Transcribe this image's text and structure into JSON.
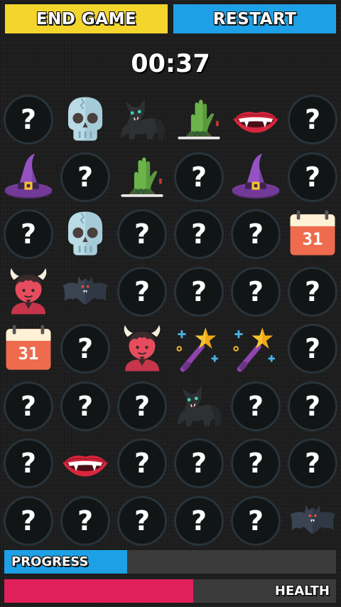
{
  "buttons": {
    "end_game": "END GAME",
    "restart": "RESTART"
  },
  "timer": "00:37",
  "hidden_symbol": "?",
  "board": {
    "columns": 6,
    "rows": [
      [
        "hidden",
        "skull",
        "black-cat",
        "zombie-hand",
        "vampire-lips",
        "hidden"
      ],
      [
        "witch-hat",
        "hidden",
        "zombie-hand",
        "hidden",
        "witch-hat",
        "hidden"
      ],
      [
        "hidden",
        "skull",
        "hidden",
        "hidden",
        "hidden",
        "calendar"
      ],
      [
        "devil",
        "bat",
        "hidden",
        "hidden",
        "hidden",
        "hidden"
      ],
      [
        "calendar",
        "hidden",
        "devil",
        "magic-wand",
        "magic-wand",
        "hidden"
      ],
      [
        "hidden",
        "hidden",
        "hidden",
        "black-cat",
        "hidden",
        "hidden"
      ],
      [
        "hidden",
        "vampire-lips",
        "hidden",
        "hidden",
        "hidden",
        "hidden"
      ],
      [
        "hidden",
        "hidden",
        "hidden",
        "hidden",
        "hidden",
        "bat"
      ]
    ]
  },
  "calendar_day": "31",
  "progress": {
    "label": "PROGRESS",
    "fraction": 0.37,
    "color": "#1ea0e6"
  },
  "health": {
    "label": "HEALTH",
    "fraction": 0.57,
    "color": "#e0205a"
  },
  "colors": {
    "end_game": "#f3d52c",
    "restart": "#1ea0e6",
    "card_back": "#121516",
    "card_ring": "#28333a"
  }
}
